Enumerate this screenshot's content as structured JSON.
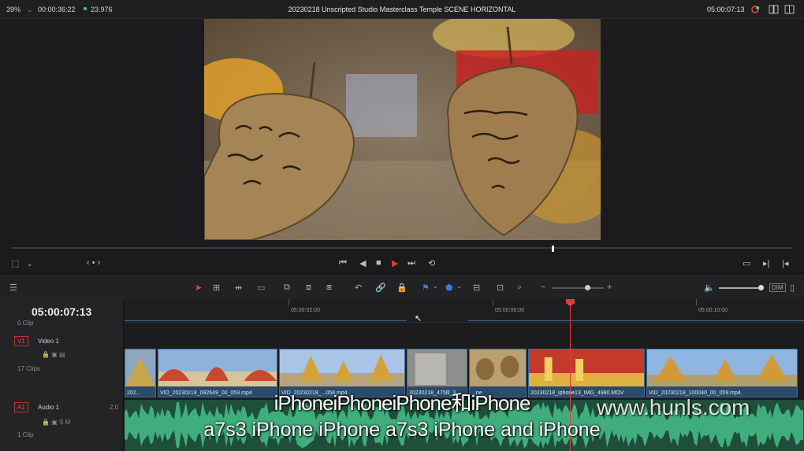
{
  "topbar": {
    "zoom": "39%",
    "timecode_left": "00:00:36:22",
    "fps": "23.976",
    "title": "20230218 Unscripted Studio Masterclass Temple SCENE HORIZONTAL",
    "timecode_right": "05:00:07:13"
  },
  "timeline": {
    "current_timecode": "05:00:07:13",
    "ruler_labels": [
      "05:00:02:00",
      "05:00:06:00",
      "05:00:10:00"
    ],
    "zero_clip_label": "0 Clip",
    "video_track": {
      "badge": "V1",
      "name": "Video 1",
      "count": "17 Clips"
    },
    "audio_track": {
      "badge": "A1",
      "name": "Audio 1",
      "level": "2.0",
      "count": "1 Clip"
    },
    "clips": [
      {
        "name": "202..."
      },
      {
        "name": "VID_20230218_092649_00_053.mp4"
      },
      {
        "name": "VID_20230218_...058.mp4"
      },
      {
        "name": "20230218_475lll_3..."
      },
      {
        "name": "...ne"
      },
      {
        "name": "20230218_iphone13_IMG_4980.MOV"
      },
      {
        "name": "VID_20230218_100040_00_059.mp4"
      }
    ]
  },
  "subtitles": {
    "line1": "iPhoneiPhoneiPhone和iPhone",
    "line2": "a7s3 iPhone iPhone a7s3 iPhone and iPhone"
  },
  "watermark": "www.hunls.com",
  "colors": {
    "accent": "#e23a3a",
    "clip_blue": "#2a4b69",
    "audio_green": "#1f4e3a"
  }
}
